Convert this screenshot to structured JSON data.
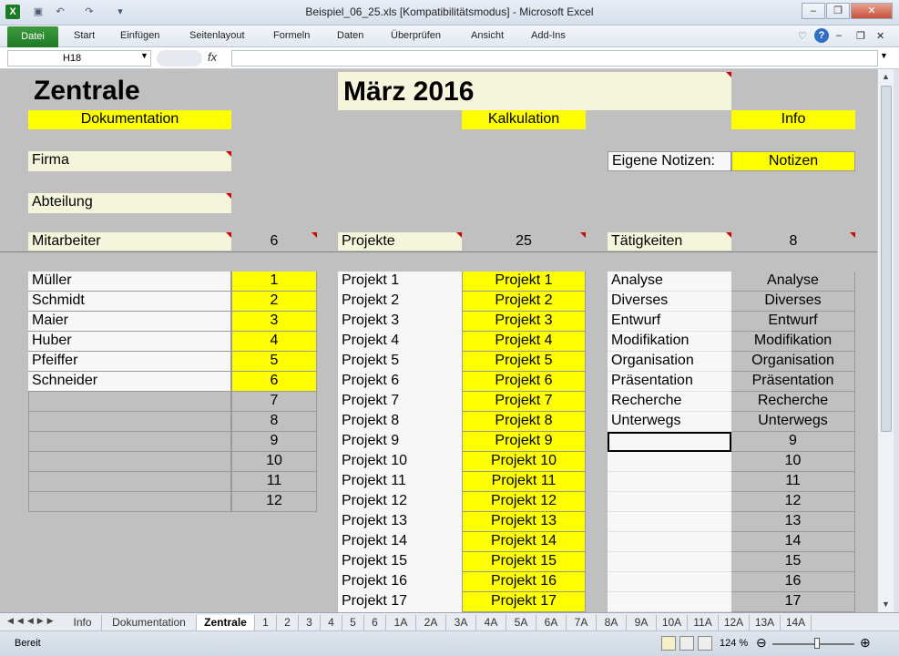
{
  "window": {
    "title": "Beispiel_06_25.xls  [Kompatibilitätsmodus]  -  Microsoft Excel"
  },
  "ribbon": {
    "file": "Datei",
    "tabs": [
      "Start",
      "Einfügen",
      "Seitenlayout",
      "Formeln",
      "Daten",
      "Überprüfen",
      "Ansicht",
      "Add-Ins"
    ]
  },
  "formula_bar": {
    "name_box": "H18",
    "fx": "fx",
    "value": ""
  },
  "sheet": {
    "heading": "Zentrale",
    "month": "März 2016",
    "dokumentation_btn": "Dokumentation",
    "kalkulation_btn": "Kalkulation",
    "info_btn": "Info",
    "firma": "Firma",
    "abteilung": "Abteilung",
    "eigene_notizen": "Eigene Notizen:",
    "notizen_btn": "Notizen",
    "mitarbeiter_label": "Mitarbeiter",
    "mitarbeiter_count": "6",
    "projekte_label": "Projekte",
    "projekte_count": "25",
    "taetigkeiten_label": "Tätigkeiten",
    "taetigkeiten_count": "8",
    "mitarbeiter": [
      "Müller",
      "Schmidt",
      "Maier",
      "Huber",
      "Pfeiffer",
      "Schneider",
      "",
      "",
      "",
      "",
      "",
      ""
    ],
    "mitarbeiter_nr": [
      "1",
      "2",
      "3",
      "4",
      "5",
      "6",
      "7",
      "8",
      "9",
      "10",
      "11",
      "12"
    ],
    "projekte": [
      "Projekt 1",
      "Projekt 2",
      "Projekt 3",
      "Projekt 4",
      "Projekt 5",
      "Projekt 6",
      "Projekt 7",
      "Projekt 8",
      "Projekt 9",
      "Projekt 10",
      "Projekt 11",
      "Projekt 12",
      "Projekt 13",
      "Projekt 14",
      "Projekt 15",
      "Projekt 16",
      "Projekt 17"
    ],
    "taetigkeiten": [
      "Analyse",
      "Diverses",
      "Entwurf",
      "Modifikation",
      "Organisation",
      "Präsentation",
      "Recherche",
      "Unterwegs",
      "",
      "",
      "",
      "",
      "",
      "",
      "",
      "",
      ""
    ],
    "taetigkeiten_rechts": [
      "Analyse",
      "Diverses",
      "Entwurf",
      "Modifikation",
      "Organisation",
      "Präsentation",
      "Recherche",
      "Unterwegs",
      "9",
      "10",
      "11",
      "12",
      "13",
      "14",
      "15",
      "16",
      "17"
    ]
  },
  "sheet_tabs": [
    "Info",
    "Dokumentation",
    "Zentrale",
    "1",
    "2",
    "3",
    "4",
    "5",
    "6",
    "1A",
    "2A",
    "3A",
    "4A",
    "5A",
    "6A",
    "7A",
    "8A",
    "9A",
    "10A",
    "11A",
    "12A",
    "13A",
    "14A"
  ],
  "active_tab": "Zentrale",
  "status": {
    "ready": "Bereit",
    "zoom": "124 %"
  }
}
